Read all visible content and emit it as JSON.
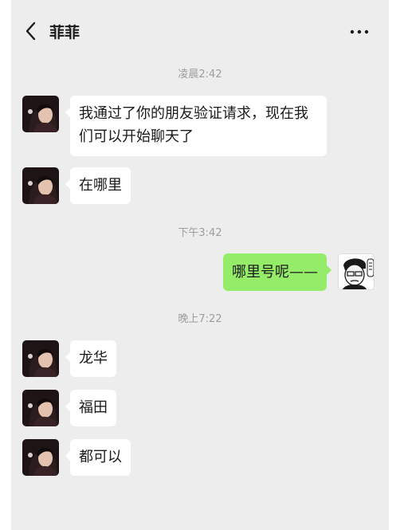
{
  "header": {
    "title": "菲菲"
  },
  "timestamps": [
    "凌晨2:42",
    "下午3:42",
    "晚上7:22"
  ],
  "messages": [
    {
      "side": "left",
      "text": "我通过了你的朋友验证请求，现在我们可以开始聊天了"
    },
    {
      "side": "left",
      "text": "在哪里"
    },
    {
      "side": "right",
      "text": "哪里号呢——"
    },
    {
      "side": "left",
      "text": "龙华"
    },
    {
      "side": "left",
      "text": "福田"
    },
    {
      "side": "left",
      "text": "都可以"
    }
  ],
  "colors": {
    "background": "#ededed",
    "sent_bubble": "#95ec69",
    "received_bubble": "#ffffff",
    "timestamp": "#9d9d9d"
  }
}
